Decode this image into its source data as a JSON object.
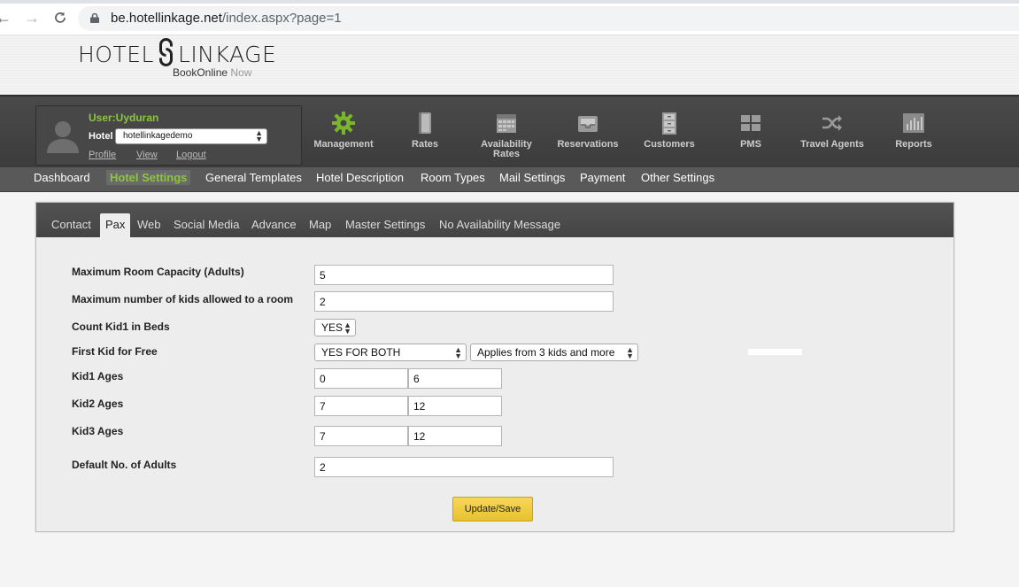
{
  "browser": {
    "url_domain": "be.hotellinkage.net",
    "url_path": "/index.aspx?page=1"
  },
  "logo": {
    "left": "HOTEL",
    "right": "LINKAGE",
    "sub_main": "BookOnline",
    "sub_now": "Now"
  },
  "user": {
    "name": "User:Uyduran",
    "hotel_label": "Hotel",
    "hotel_value": "hotellinkagedemo",
    "links": [
      "Profile",
      "View",
      "Logout"
    ]
  },
  "main_nav": [
    {
      "label": "Management",
      "icon": "gear-icon"
    },
    {
      "label": "Rates",
      "icon": "book-icon"
    },
    {
      "label": "Availability Rates",
      "icon": "calendar-icon"
    },
    {
      "label": "Reservations",
      "icon": "inbox-tray-icon"
    },
    {
      "label": "Customers",
      "icon": "file-cabinet-icon"
    },
    {
      "label": "PMS",
      "icon": "grid-icon"
    },
    {
      "label": "Travel Agents",
      "icon": "shuffle-icon"
    },
    {
      "label": "Reports",
      "icon": "bar-chart-icon"
    }
  ],
  "sub_nav": [
    "Dashboard",
    "Hotel Settings",
    "General Templates",
    "Hotel Description",
    "Room Types",
    "Mail Settings",
    "Payment",
    "Other Settings"
  ],
  "sub_nav_active": "Hotel Settings",
  "tabs": [
    "Contact",
    "Pax",
    "Web",
    "Social Media",
    "Advance",
    "Map",
    "Master Settings",
    "No Availability Message"
  ],
  "tabs_active": "Pax",
  "form": {
    "max_room_capacity_label": "Maximum Room Capacity (Adults)",
    "max_room_capacity_value": "5",
    "max_kids_label": "Maximum number of kids allowed to a room",
    "max_kids_value": "2",
    "count_kid1_label": "Count Kid1 in Beds",
    "count_kid1_value": "YES",
    "first_kid_free_label": "First Kid for Free",
    "first_kid_free_value": "YES FOR BOTH",
    "first_kid_applies_value": "Applies from 3 kids and more",
    "kid1_label": "Kid1 Ages",
    "kid1_from": "0",
    "kid1_to": "6",
    "kid2_label": "Kid2 Ages",
    "kid2_from": "7",
    "kid2_to": "12",
    "kid3_label": "Kid3 Ages",
    "kid3_from": "7",
    "kid3_to": "12",
    "default_adults_label": "Default No. of Adults",
    "default_adults_value": "2",
    "save_label": "Update/Save"
  }
}
